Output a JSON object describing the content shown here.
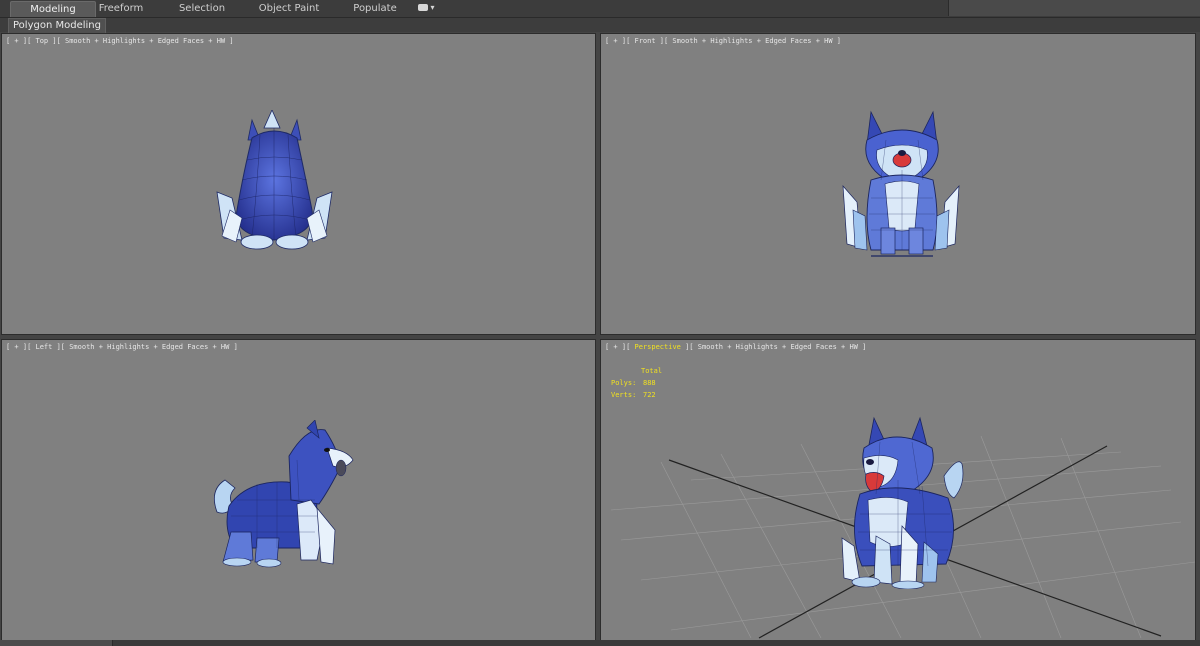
{
  "ribbon": {
    "tabs": [
      {
        "label": "Modeling",
        "active": true
      },
      {
        "label": "Freeform",
        "active": false
      },
      {
        "label": "Selection",
        "active": false
      },
      {
        "label": "Object Paint",
        "active": false
      },
      {
        "label": "Populate",
        "active": false
      }
    ],
    "extra_icon": "camera-dropdown-icon",
    "panel_label": "Polygon Modeling"
  },
  "viewports": {
    "top": {
      "label": "[ + ][ Top ][ Smooth + Highlights + Edged Faces + HW ]"
    },
    "front": {
      "label": "[ + ][ Front ][ Smooth + Highlights + Edged Faces + HW ]"
    },
    "left": {
      "label": "[ + ][ Left ][ Smooth + Highlights + Edged Faces + HW ]"
    },
    "perspective": {
      "label_prefix": "[ + ][ ",
      "view_name": "Perspective",
      "label_suffix": " ][ Smooth + Highlights + Edged Faces + HW ]",
      "stats": {
        "header": "Total",
        "polys_label": "Polys:",
        "polys_value": "888",
        "verts_label": "Verts:",
        "verts_value": "722"
      }
    }
  },
  "colors": {
    "viewport_bg": "#808080",
    "model_dark_blue": "#2f3fa6",
    "model_mid_blue": "#4f6ad6",
    "model_light_blue": "#cfe3f6",
    "tongue_red": "#d83a3a",
    "stats_yellow": "#f0e020"
  }
}
